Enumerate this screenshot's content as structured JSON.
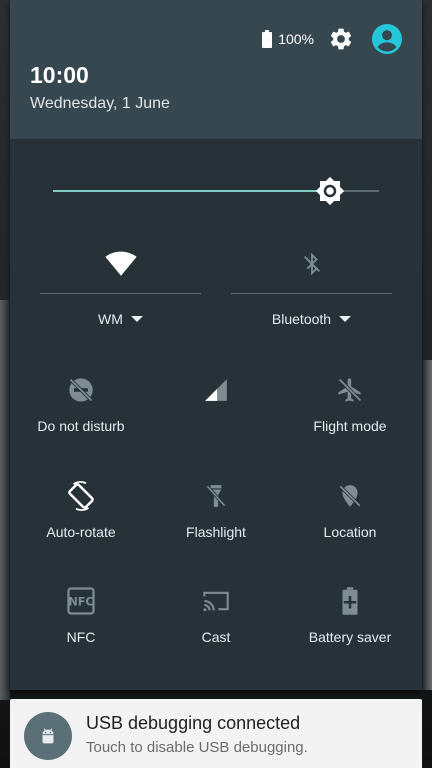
{
  "status": {
    "battery_text": "100%"
  },
  "header": {
    "time": "10:00",
    "date": "Wednesday, 1 June"
  },
  "brightness": {
    "level_fraction": 0.85
  },
  "wifi": {
    "label": "WM",
    "icon": "wifi-icon",
    "active": true
  },
  "bluetooth": {
    "label": "Bluetooth",
    "icon": "bluetooth-icon",
    "active": false
  },
  "tiles": [
    {
      "key": "dnd",
      "label": "Do not disturb",
      "icon": "do-not-disturb-icon"
    },
    {
      "key": "signal",
      "label": "",
      "icon": "signal-icon"
    },
    {
      "key": "flight",
      "label": "Flight mode",
      "icon": "airplane-icon"
    },
    {
      "key": "rotate",
      "label": "Auto-rotate",
      "icon": "auto-rotate-icon"
    },
    {
      "key": "flashlight",
      "label": "Flashlight",
      "icon": "flashlight-icon"
    },
    {
      "key": "location",
      "label": "Location",
      "icon": "location-off-icon"
    },
    {
      "key": "nfc",
      "label": "NFC",
      "icon": "nfc-icon"
    },
    {
      "key": "cast",
      "label": "Cast",
      "icon": "cast-icon"
    },
    {
      "key": "battery_saver",
      "label": "Battery saver",
      "icon": "battery-saver-icon"
    }
  ],
  "notification": {
    "title": "USB debugging connected",
    "text": "Touch to disable USB debugging.",
    "icon": "android-icon"
  },
  "colors": {
    "panel": "#263238",
    "header": "#37474f",
    "accent": "#80cbc4",
    "account": "#26c6da",
    "inactive_icon": "#7f8c91"
  }
}
